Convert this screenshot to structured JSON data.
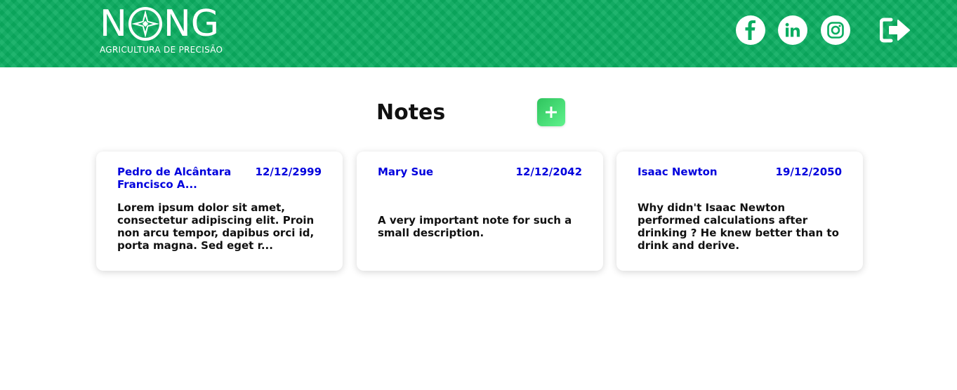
{
  "header": {
    "logo": {
      "word_left": "N",
      "word_right": "NG",
      "tagline": "AGRICULTURA DE PRECISÃO"
    },
    "social": [
      {
        "name": "facebook",
        "icon": "facebook-icon"
      },
      {
        "name": "linkedin",
        "icon": "linkedin-icon"
      },
      {
        "name": "instagram",
        "icon": "instagram-icon"
      }
    ],
    "logout_icon": "logout-icon",
    "background_color": "#0aad60"
  },
  "main": {
    "title": "Notes",
    "add_button_icon": "plus-icon",
    "notes": [
      {
        "author": "Pedro de Alcântara Francisco A...",
        "date": "12/12/2999",
        "text": "Lorem ipsum dolor sit amet, consectetur adipiscing elit. Proin non arcu tempor, dapibus orci id, porta magna. Sed eget r..."
      },
      {
        "author": "Mary Sue",
        "date": "12/12/2042",
        "text": "A very important note for such a small description."
      },
      {
        "author": "Isaac Newton",
        "date": "19/12/2050",
        "text": "Why didn't Isaac Newton performed calculations after drinking ? He knew better than to drink and derive."
      }
    ]
  },
  "colors": {
    "accent": "#0aad60",
    "author": "#0000dd",
    "button_gradient": [
      "#2fc45e",
      "#5ff28c"
    ]
  }
}
